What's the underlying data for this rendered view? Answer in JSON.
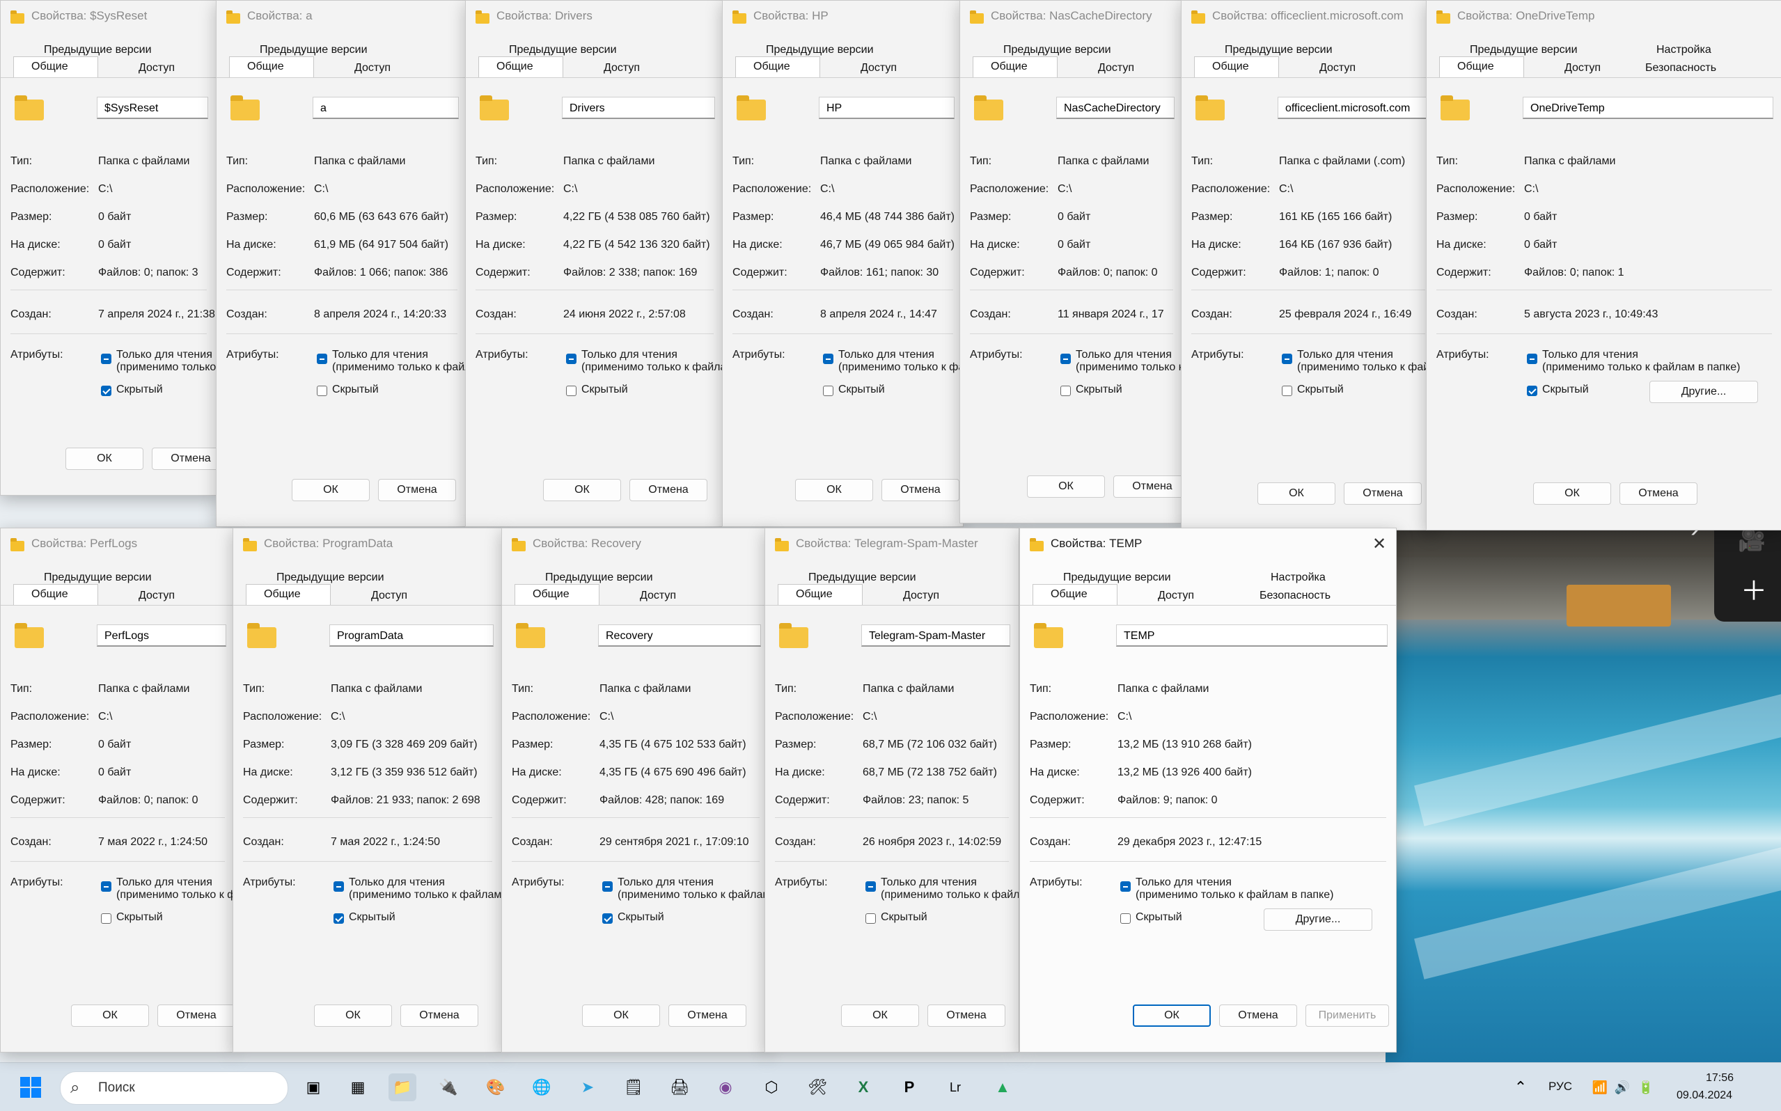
{
  "colors": {
    "accent": "#0067c0",
    "folder": "#f5c02d",
    "taskbar": "#d9e3ec"
  },
  "labels": {
    "tab_prev": "Предыдущие версии",
    "tab_general": "Общие",
    "tab_access": "Доступ",
    "tab_settings": "Настройка",
    "tab_security": "Безопасность",
    "type": "Тип:",
    "location": "Расположение:",
    "size": "Размер:",
    "on_disk": "На диске:",
    "contains": "Содержит:",
    "created": "Создан:",
    "attributes": "Атрибуты:",
    "readonly_line1": "Только для чтения",
    "readonly_line2": "(применимо только к файлам в папке)",
    "hidden": "Скрытый",
    "ok": "ОК",
    "cancel": "Отмена",
    "apply": "Применить",
    "other": "Другие..."
  },
  "windows": [
    {
      "title": "Свойства: $SysReset",
      "name": "$SysReset",
      "type": "Папка с файлами",
      "location": "C:\\",
      "size": "0 байт",
      "on_disk": "0 байт",
      "contains": "Файлов: 0; папок: 3",
      "created": "7 апреля 2024 г., 21:38",
      "hidden": true
    },
    {
      "title": "Свойства: a",
      "name": "a",
      "type": "Папка с файлами",
      "location": "C:\\",
      "size": "60,6 МБ (63 643 676 байт)",
      "on_disk": "61,9 МБ (64 917 504 байт)",
      "contains": "Файлов: 1 066; папок: 386",
      "created": "8 апреля 2024 г., 14:20:33",
      "hidden": false
    },
    {
      "title": "Свойства: Drivers",
      "name": "Drivers",
      "type": "Папка с файлами",
      "location": "C:\\",
      "size": "4,22 ГБ (4 538 085 760 байт)",
      "on_disk": "4,22 ГБ (4 542 136 320 байт)",
      "contains": "Файлов: 2 338; папок: 169",
      "created": "24 июня 2022 г., 2:57:08",
      "hidden": false
    },
    {
      "title": "Свойства: HP",
      "name": "HP",
      "type": "Папка с файлами",
      "location": "C:\\",
      "size": "46,4 МБ (48 744 386 байт)",
      "on_disk": "46,7 МБ (49 065 984 байт)",
      "contains": "Файлов: 161; папок: 30",
      "created": "8 апреля 2024 г., 14:47",
      "hidden": false
    },
    {
      "title": "Свойства: NasCacheDirectory",
      "name": "NasCacheDirectory",
      "type": "Папка с файлами",
      "location": "C:\\",
      "size": "0 байт",
      "on_disk": "0 байт",
      "contains": "Файлов: 0; папок: 0",
      "created": "11 января 2024 г., 17",
      "hidden": false
    },
    {
      "title": "Свойства: officeclient.microsoft.com",
      "name": "officeclient.microsoft.com",
      "type": "Папка с файлами (.com)",
      "location": "C:\\",
      "size": "161 КБ (165 166 байт)",
      "on_disk": "164 КБ (167 936 байт)",
      "contains": "Файлов: 1; папок: 0",
      "created": "25 февраля 2024 г., 16:49",
      "hidden": false
    },
    {
      "title": "Свойства: OneDriveTemp",
      "name": "OneDriveTemp",
      "type": "Папка с файлами",
      "location": "C:\\",
      "size": "0 байт",
      "on_disk": "0 байт",
      "contains": "Файлов: 0; папок: 1",
      "created": "5 августа 2023 г., 10:49:43",
      "hidden": true
    },
    {
      "title": "Свойства: PerfLogs",
      "name": "PerfLogs",
      "type": "Папка с файлами",
      "location": "C:\\",
      "size": "0 байт",
      "on_disk": "0 байт",
      "contains": "Файлов: 0; папок: 0",
      "created": "7 мая 2022 г., 1:24:50",
      "hidden": false
    },
    {
      "title": "Свойства: ProgramData",
      "name": "ProgramData",
      "type": "Папка с файлами",
      "location": "C:\\",
      "size": "3,09 ГБ (3 328 469 209 байт)",
      "on_disk": "3,12 ГБ (3 359 936 512 байт)",
      "contains": "Файлов: 21 933; папок: 2 698",
      "created": "7 мая 2022 г., 1:24:50",
      "hidden": true
    },
    {
      "title": "Свойства: Recovery",
      "name": "Recovery",
      "type": "Папка с файлами",
      "location": "C:\\",
      "size": "4,35 ГБ (4 675 102 533 байт)",
      "on_disk": "4,35 ГБ (4 675 690 496 байт)",
      "contains": "Файлов: 428; папок: 169",
      "created": "29 сентября 2021 г., 17:09:10",
      "hidden": true
    },
    {
      "title": "Свойства: Telegram-Spam-Master",
      "name": "Telegram-Spam-Master",
      "type": "Папка с файлами",
      "location": "C:\\",
      "size": "68,7 МБ (72 106 032 байт)",
      "on_disk": "68,7 МБ (72 138 752 байт)",
      "contains": "Файлов: 23; папок: 5",
      "created": "26 ноября 2023 г., 14:02:59",
      "hidden": false
    },
    {
      "title": "Свойства: TEMP",
      "name": "TEMP",
      "type": "Папка с файлами",
      "location": "C:\\",
      "size": "13,2 МБ (13 910 268 байт)",
      "on_disk": "13,2 МБ (13 926 400 байт)",
      "contains": "Файлов: 9; папок: 0",
      "created": "29 декабря 2023 г., 12:47:15",
      "hidden": false
    }
  ],
  "taskbar": {
    "search_placeholder": "Поиск",
    "language": "РУС",
    "time": "17:56",
    "date": "09.04.2024"
  }
}
